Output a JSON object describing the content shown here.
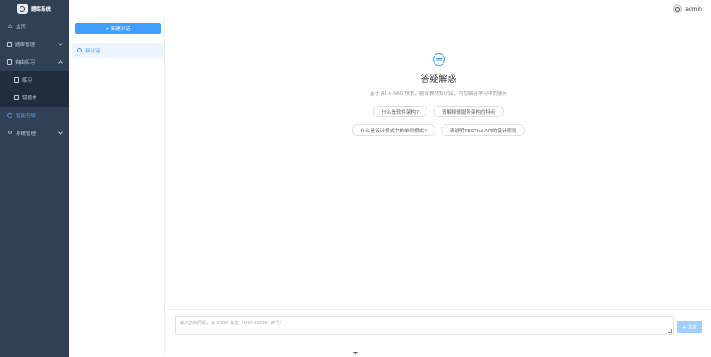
{
  "app": {
    "brand": "题库系统"
  },
  "sidebar": {
    "items": [
      {
        "label": "主页"
      },
      {
        "label": "题库管理"
      },
      {
        "label": "自由练习"
      },
      {
        "label": "练习"
      },
      {
        "label": "错题本"
      },
      {
        "label": "智能答疑"
      },
      {
        "label": "系统管理"
      }
    ]
  },
  "topbar": {
    "username": "admin"
  },
  "conversations": {
    "new_label": "+ 新建对话",
    "items": [
      {
        "label": "新对话"
      }
    ]
  },
  "welcome": {
    "title": "答疑解惑",
    "subtitle": "基于 AI + RAG 技术，结合教材知识库，为您解答学习中的疑问",
    "suggestions": [
      "什么是软件架构?",
      "请解释微服务架构的特点",
      "什么是设计模式中的单例模式?",
      "请说明RESTful API的设计原则"
    ]
  },
  "composer": {
    "placeholder": "输入您的问题，按 Enter 发送（Shift+Enter 换行）",
    "send_label": "➤ 发送"
  },
  "colors": {
    "accent": "#409eff",
    "sidebar_bg": "#304156",
    "submenu_bg": "#1f2d3d"
  }
}
